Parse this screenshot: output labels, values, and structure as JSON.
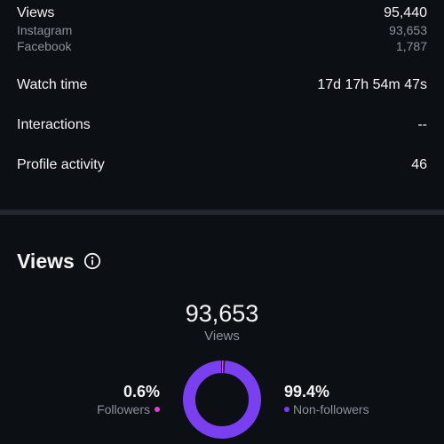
{
  "metrics": {
    "views": {
      "label": "Views",
      "value": "95,440"
    },
    "instagram": {
      "label": "Instagram",
      "value": "93,653"
    },
    "facebook": {
      "label": "Facebook",
      "value": "1,787"
    },
    "watch_time": {
      "label": "Watch time",
      "value": "17d 17h 54m 47s"
    },
    "interactions": {
      "label": "Interactions",
      "value": "--"
    },
    "profile_activity": {
      "label": "Profile activity",
      "value": "46"
    }
  },
  "views_section": {
    "title": "Views",
    "info_icon": "info-icon",
    "total": "93,653",
    "total_label": "Views",
    "followers": {
      "percent": "0.6%",
      "label": "Followers",
      "fraction": 0.006,
      "color": "#e040d0"
    },
    "non_followers": {
      "percent": "99.4%",
      "label": "Non-followers",
      "fraction": 0.994,
      "color": "#7a3ff0"
    }
  },
  "colors": {
    "background": "#0c0f14",
    "divider": "#23262c",
    "secondary_text": "#8c9199"
  }
}
